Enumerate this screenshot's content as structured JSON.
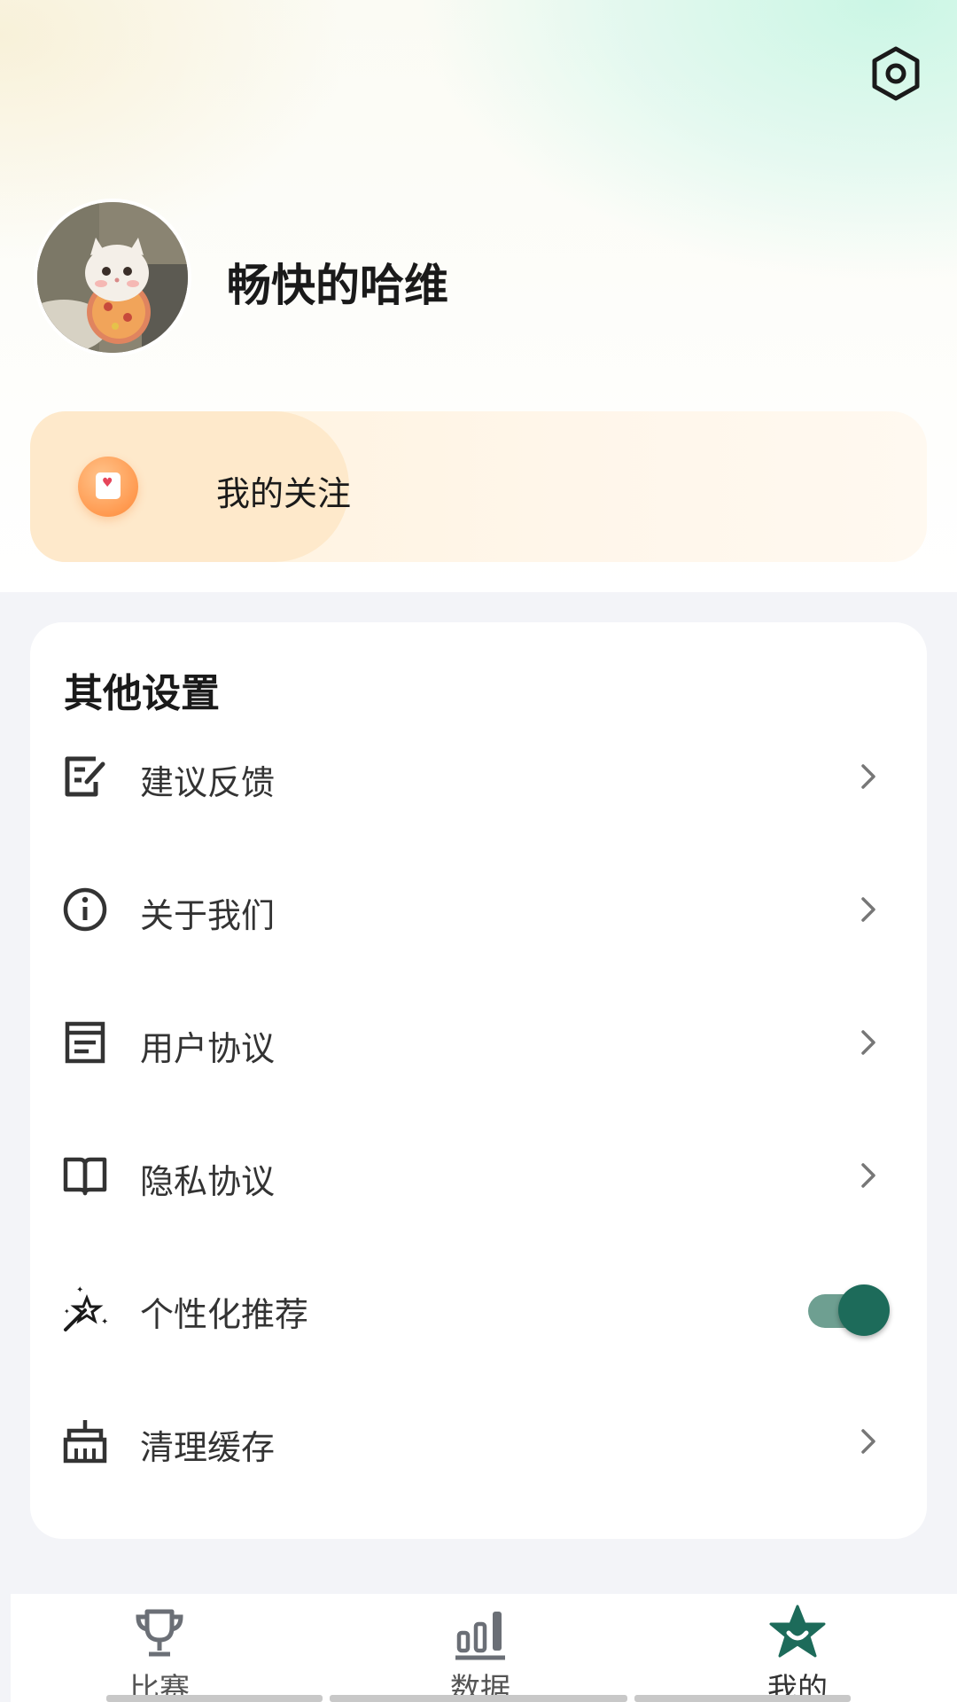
{
  "profile": {
    "username": "畅快的哈维",
    "avatar_alt": "avatar"
  },
  "header": {
    "settings_icon": "settings-hexagon-icon"
  },
  "follow_card": {
    "label": "我的关注",
    "icon": "bookmark-heart-icon"
  },
  "other_settings": {
    "title": "其他设置",
    "items": [
      {
        "label": "建议反馈",
        "icon": "feedback-edit-icon",
        "control": "chevron"
      },
      {
        "label": "关于我们",
        "icon": "info-icon",
        "control": "chevron"
      },
      {
        "label": "用户协议",
        "icon": "document-icon",
        "control": "chevron"
      },
      {
        "label": "隐私协议",
        "icon": "book-icon",
        "control": "chevron"
      },
      {
        "label": "个性化推荐",
        "icon": "magic-wand-icon",
        "control": "toggle",
        "enabled": true
      },
      {
        "label": "清理缓存",
        "icon": "broom-icon",
        "control": "chevron"
      }
    ]
  },
  "tabbar": {
    "tabs": [
      {
        "label": "比赛",
        "icon": "trophy-icon",
        "active": false
      },
      {
        "label": "数据",
        "icon": "bar-chart-icon",
        "active": false
      },
      {
        "label": "我的",
        "icon": "star-smile-icon",
        "active": true
      }
    ]
  },
  "colors": {
    "accent": "#1d6b5a",
    "follow_icon": "#ff9a50",
    "background": "#f3f4f8"
  }
}
